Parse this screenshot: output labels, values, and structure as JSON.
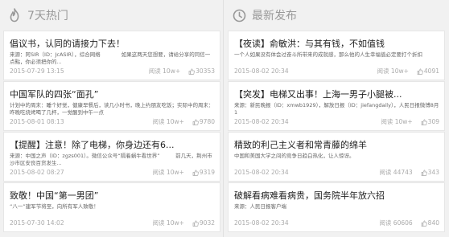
{
  "left": {
    "header": {
      "title": "7天热门",
      "icon": "flame-icon"
    },
    "cards": [
      {
        "title": "倡议书，认同的请接力下去！",
        "desc": "来源：阿SIR（ID：JcASIR），综合网络　　　　如果这两天您想要，请给分享的同信一点點，你必须把你的...",
        "date": "2015-07-29 13:15",
        "reads": "阅读 10w+",
        "likes": "30353"
      },
      {
        "title": "中国军队的四张“面孔”",
        "desc": "计划中的周末：睡个好觉，健康早餐后，读几小时书，晚上约朋友吃饭；实际中的周末：昨晚吃烧烤喝了几杯，一觉醒到中午一点",
        "date": "2015-08-01 08:13",
        "reads": "阅读 10w+",
        "likes": "9780"
      },
      {
        "title": "【提醒】注意！除了电梯，你身边还有6...",
        "desc": "来源：中国之声（ID：zgzs001）。微信公众号“隔着蜗牛看世界”　　　前几天，荆州市沙市区安良百货发生...",
        "date": "2015-08-02 08:27",
        "reads": "阅读 10w+",
        "likes": "9319"
      },
      {
        "title": "致敬！中国“第一男团”",
        "desc": "“八一”建军节将至，向所有军人致敬！",
        "date": "2015-07-30 14:02",
        "reads": "阅读 10w+",
        "likes": "9032"
      }
    ]
  },
  "right": {
    "header": {
      "title": "最新发布",
      "icon": "clock-icon"
    },
    "cards": [
      {
        "title": "【夜读】俞敏洪：与其有钱，不如值钱",
        "desc": "一个人如果没有体会过奋斗所带来的成就感，那么他的人生幸福值必定要打个折扣",
        "date": "2015-08-02 20:34",
        "reads": "阅读 10w+",
        "likes": "4091"
      },
      {
        "title": "【突发】电梯又出事！上海一男子小腿被...",
        "desc": "来源：新民晚报（ID：xmwb1929），解放日报（ID：jiefangdaily），人民日报微博8月1",
        "date": "2015-08-02 20:34",
        "reads": "阅读 10w+",
        "likes": "309"
      },
      {
        "title": "精致的利己主义者和常青藤的绵羊",
        "desc": "中国和美国大学之间的竞争日趋白热化，让人惊讶。",
        "date": "2015-08-02 20:34",
        "reads": "阅读 44743",
        "likes": "343"
      },
      {
        "title": "破解看病难看病贵，国务院半年放六招",
        "desc": "来源：人民日报客户端",
        "date": "2015-08-02 20:34",
        "reads": "阅读 60606",
        "likes": "840"
      }
    ]
  }
}
